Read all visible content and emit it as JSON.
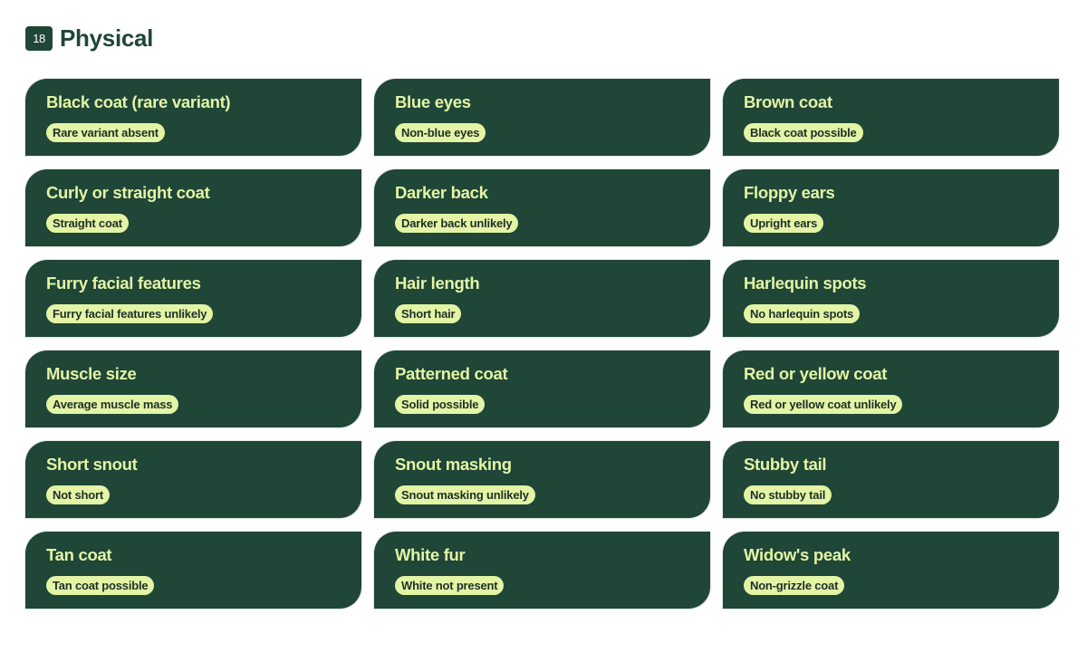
{
  "section": {
    "count": "18",
    "title": "Physical"
  },
  "colors": {
    "card_background": "#1f4637",
    "title_text": "#e3f5a5",
    "pill_background": "#e3f5a5",
    "pill_text": "#1f2e28"
  },
  "traits": [
    {
      "title": "Black coat (rare variant)",
      "result": "Rare variant absent"
    },
    {
      "title": "Blue eyes",
      "result": "Non-blue eyes"
    },
    {
      "title": "Brown coat",
      "result": "Black coat possible"
    },
    {
      "title": "Curly or straight coat",
      "result": "Straight coat"
    },
    {
      "title": "Darker back",
      "result": "Darker back unlikely"
    },
    {
      "title": "Floppy ears",
      "result": "Upright ears"
    },
    {
      "title": "Furry facial features",
      "result": "Furry facial features unlikely"
    },
    {
      "title": "Hair length",
      "result": "Short hair"
    },
    {
      "title": "Harlequin spots",
      "result": "No harlequin spots"
    },
    {
      "title": "Muscle size",
      "result": "Average muscle mass"
    },
    {
      "title": "Patterned coat",
      "result": "Solid possible"
    },
    {
      "title": "Red or yellow coat",
      "result": "Red or yellow coat unlikely"
    },
    {
      "title": "Short snout",
      "result": "Not short"
    },
    {
      "title": "Snout masking",
      "result": "Snout masking unlikely"
    },
    {
      "title": "Stubby tail",
      "result": "No stubby tail"
    },
    {
      "title": "Tan coat",
      "result": "Tan coat possible"
    },
    {
      "title": "White fur",
      "result": "White not present"
    },
    {
      "title": "Widow's peak",
      "result": "Non-grizzle coat"
    }
  ]
}
